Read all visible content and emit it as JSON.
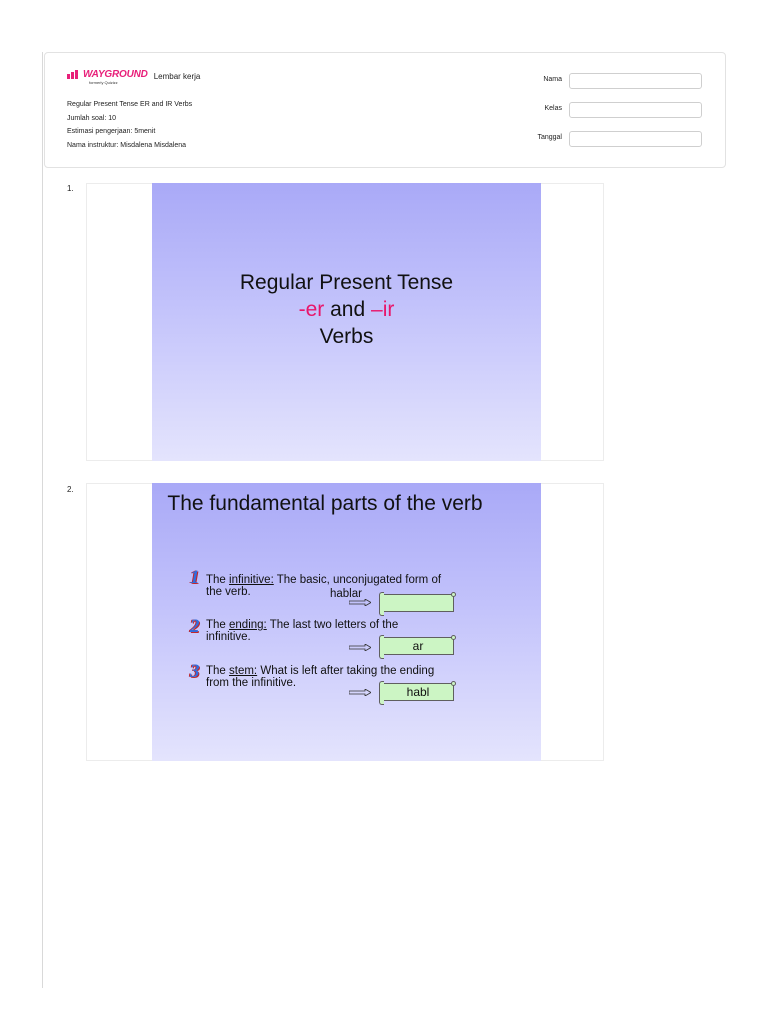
{
  "header": {
    "logo_text": "WAYGROUND",
    "logo_sub": "formerly Quizizz",
    "doc_type": "Lembar kerja",
    "meta": [
      "Regular Present Tense ER and IR Verbs",
      "Jumlah soal: 10",
      "Estimasi pengerjaan: 5menit",
      "Nama instruktur: Misdalena Misdalena"
    ],
    "fields": [
      {
        "label": "Nama",
        "value": ""
      },
      {
        "label": "Kelas",
        "value": ""
      },
      {
        "label": "Tanggal",
        "value": ""
      }
    ],
    "brand_color": "#e8207a"
  },
  "questions": [
    {
      "number": "1.",
      "slide": {
        "line1": "Regular Present Tense",
        "line2_a": "-er",
        "line2_b": " and ",
        "line2_c": "–ir",
        "line3": "Verbs"
      }
    },
    {
      "number": "2.",
      "slide": {
        "title": "The fundamental parts of the verb",
        "parts": [
          {
            "num": "1",
            "pre": "The ",
            "term": "infinitive:",
            "rest": " The basic, unconjugated form of the verb.",
            "example": "hablar",
            "box": ""
          },
          {
            "num": "2",
            "pre": "The ",
            "term": "ending:",
            "rest": "  The last two letters of the infinitive.",
            "example": "",
            "box": "ar"
          },
          {
            "num": "3",
            "pre": "The ",
            "term": "stem:",
            "rest": "  What is left after taking the ending from the infinitive.",
            "example": "",
            "box": "habl"
          }
        ]
      }
    }
  ]
}
